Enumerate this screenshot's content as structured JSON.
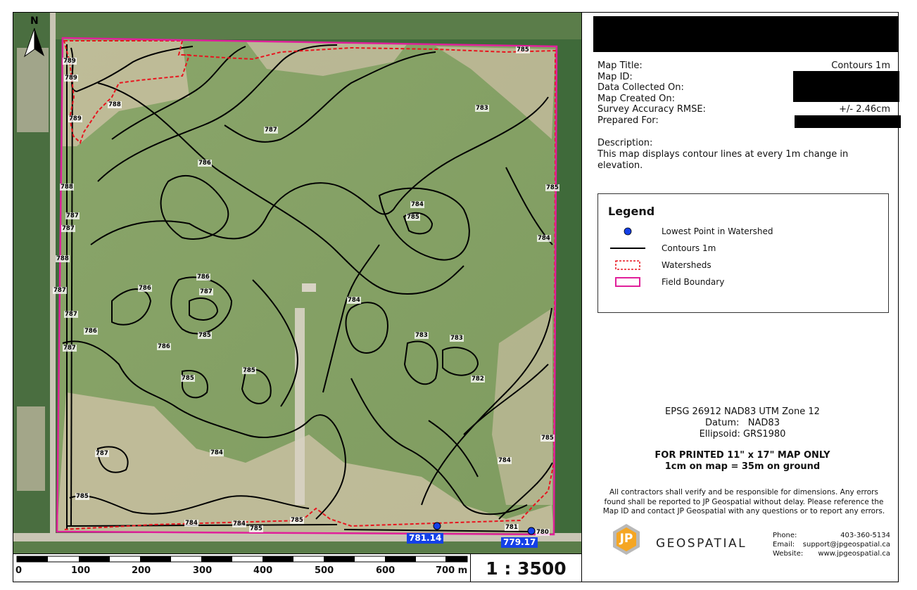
{
  "map": {
    "north_label": "N",
    "contour_labels": [
      "789",
      "789",
      "788",
      "789",
      "787",
      "786",
      "788",
      "787",
      "787",
      "788",
      "787",
      "787",
      "786",
      "787",
      "786",
      "787",
      "786",
      "785",
      "786",
      "785",
      "785",
      "787",
      "784",
      "785",
      "784",
      "785",
      "784",
      "785",
      "784",
      "784",
      "783",
      "783",
      "783",
      "782",
      "785",
      "784",
      "785",
      "784",
      "783",
      "781",
      "780",
      "785",
      "785"
    ],
    "lowest_points": [
      "781.14",
      "779.17"
    ],
    "colors": {
      "contour": "#000000",
      "watershed": "#e8141e",
      "boundary": "#e0209a",
      "lowest_point": "#1440e8"
    }
  },
  "scale_bar": {
    "ticks": [
      "0",
      "100",
      "200",
      "300",
      "400",
      "500",
      "600",
      "700 m"
    ],
    "ratio": "1 : 3500"
  },
  "info": {
    "rows": [
      {
        "label": "Map Title:",
        "value": "Contours 1m"
      },
      {
        "label": "Map ID:",
        "value": ""
      },
      {
        "label": "Data Collected On:",
        "value": ""
      },
      {
        "label": "Map Created On:",
        "value": ""
      },
      {
        "label": "Survey Accuracy RMSE:",
        "value": "+/- 2.46cm"
      },
      {
        "label": "Prepared For:",
        "value": ""
      }
    ],
    "description_label": "Description:",
    "description_text": "This map displays contour lines at every 1m change in elevation."
  },
  "legend": {
    "title": "Legend",
    "items": [
      {
        "label": "Lowest Point in Watershed",
        "icon": "blue-dot-icon"
      },
      {
        "label": "Contours 1m",
        "icon": "black-line-icon"
      },
      {
        "label": "Watersheds",
        "icon": "red-dashed-box-icon"
      },
      {
        "label": "Field Boundary",
        "icon": "magenta-box-icon"
      }
    ]
  },
  "projection": {
    "epsg": "EPSG 26912 NAD83 UTM Zone 12",
    "datum_label": "Datum:",
    "datum": "NAD83",
    "ellipsoid_label": "Ellipsoid:",
    "ellipsoid": "GRS1980"
  },
  "print_note": {
    "line1": "FOR PRINTED 11\" x 17\" MAP ONLY",
    "line2": "1cm on map = 35m on ground"
  },
  "disclaimer": "All contractors shall verify and be responsible for dimensions. Any errors found shall be reported to JP Geospatial without delay. Please reference the Map ID and contact JP Geospatial with any questions or to report any errors.",
  "brand": {
    "logo_text": "JP",
    "name": "GEOSPATIAL",
    "phone_label": "Phone:",
    "phone": "403-360-5134",
    "email_label": "Email:",
    "email": "support@jpgeospatial.ca",
    "website_label": "Website:",
    "website": "www.jpgeospatial.ca"
  }
}
